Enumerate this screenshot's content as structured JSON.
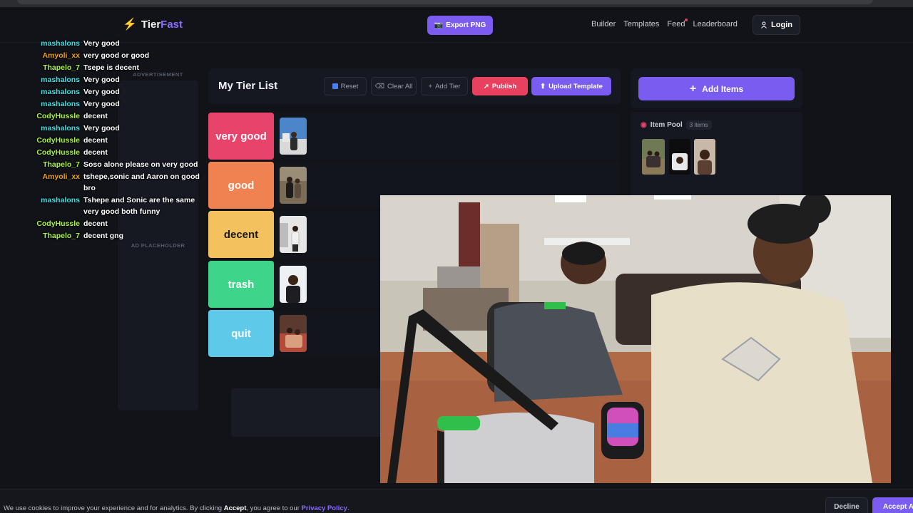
{
  "app": {
    "logo_word1": "Tier",
    "logo_word2": "Fast",
    "export_label": "Export PNG",
    "nav": [
      "Builder",
      "Templates",
      "Feed",
      "Leaderboard"
    ],
    "login_label": "Login"
  },
  "ads": {
    "advertisement": "ADVERTISEMENT",
    "placeholder": "AD PLACEHOLDER"
  },
  "tierlist": {
    "title": "My Tier List",
    "reset": "Reset",
    "clear_all": "Clear All",
    "add_tier": "Add Tier",
    "publish": "Publish",
    "upload_template": "Upload Template",
    "tiers": [
      {
        "label": "very good",
        "color": "#e8436a"
      },
      {
        "label": "good",
        "color": "#ef8250"
      },
      {
        "label": "decent",
        "color": "#f4c15f"
      },
      {
        "label": "trash",
        "color": "#3ed489"
      },
      {
        "label": "quit",
        "color": "#5ec9e8"
      }
    ]
  },
  "pool": {
    "add_items": "Add Items",
    "title": "Item Pool",
    "count": "3 items"
  },
  "chat": [
    {
      "user": "mashalons",
      "color": "#3ee0e6",
      "msg": "Very good"
    },
    {
      "user": "Amyoli_xx",
      "color": "#f0a020",
      "msg": "very good or good"
    },
    {
      "user": "Thapelo_7",
      "color": "#a8f04a",
      "msg": "Tsepe is decent"
    },
    {
      "user": "mashalons",
      "color": "#3ee0e6",
      "msg": "Very good"
    },
    {
      "user": "mashalons",
      "color": "#3ee0e6",
      "msg": "Very good"
    },
    {
      "user": "mashalons",
      "color": "#3ee0e6",
      "msg": "Very good"
    },
    {
      "user": "CodyHussle",
      "color": "#a8f04a",
      "msg": "decent"
    },
    {
      "user": "mashalons",
      "color": "#3ee0e6",
      "msg": "Very good"
    },
    {
      "user": "CodyHussle",
      "color": "#a8f04a",
      "msg": "decent"
    },
    {
      "user": "CodyHussle",
      "color": "#a8f04a",
      "msg": "decent"
    },
    {
      "user": "Thapelo_7",
      "color": "#a8f04a",
      "msg": "Soso alone please on very good"
    },
    {
      "user": "Amyoli_xx",
      "color": "#f0a020",
      "msg": "tshepe,sonic and Aaron on good",
      "msg2": "bro"
    },
    {
      "user": "mashalons",
      "color": "#3ee0e6",
      "msg": "Tshepe and Sonic are the same",
      "msg2": "very good both funny"
    },
    {
      "user": "CodyHussle",
      "color": "#a8f04a",
      "msg": "decent"
    },
    {
      "user": "Thapelo_7",
      "color": "#a8f04a",
      "msg": "decent gng"
    }
  ],
  "cookie": {
    "text1": "We use cookies to improve your experience and for analytics. By clicking ",
    "accept_word": "Accept",
    "text2": ", you agree to our ",
    "policy": "Privacy Policy",
    "text3": ".",
    "decline": "Decline",
    "accept": "Accept A"
  }
}
